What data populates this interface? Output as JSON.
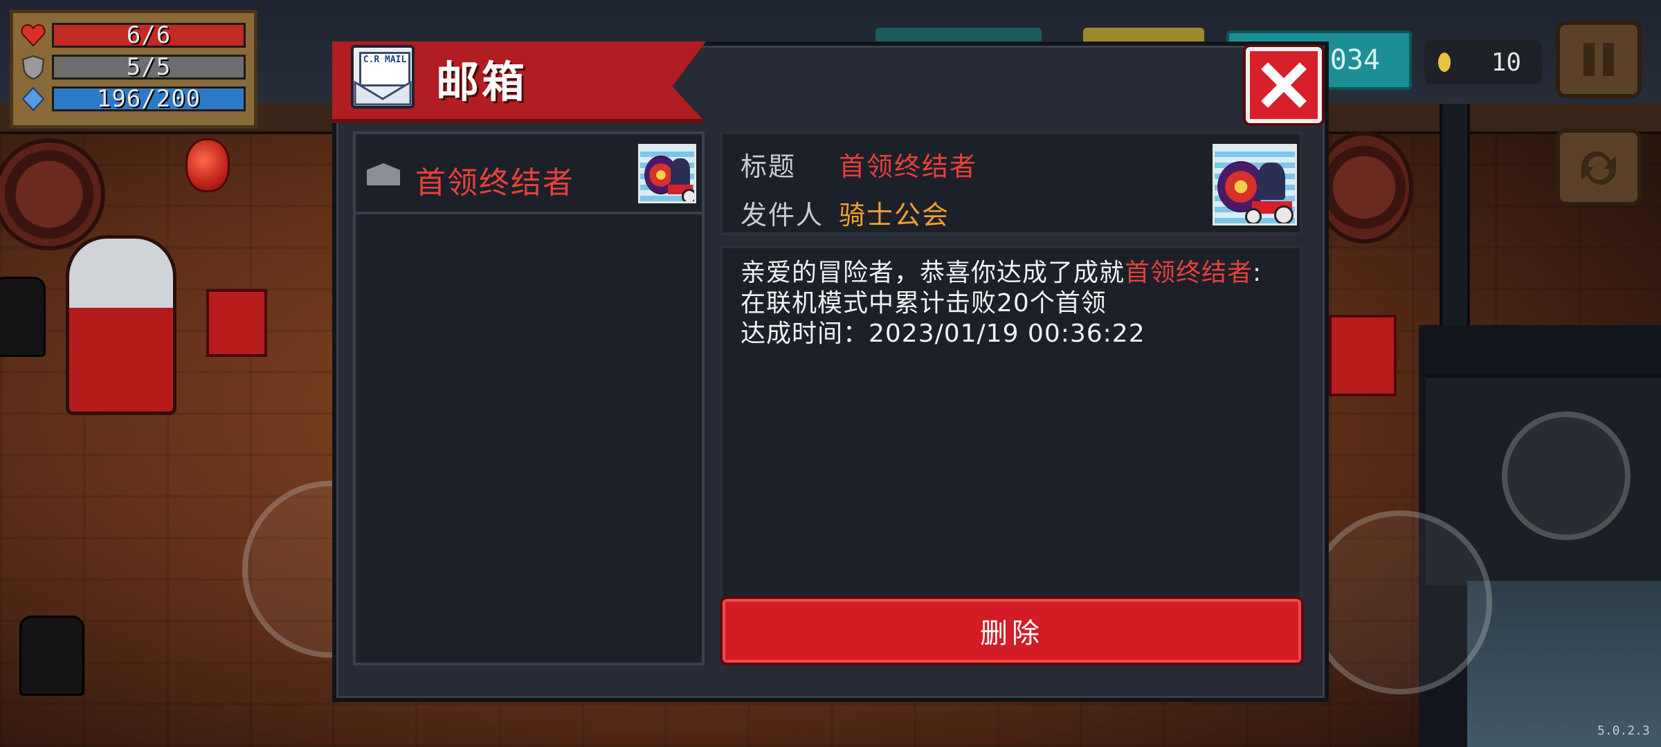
{
  "hud": {
    "hp": "6/6",
    "armor": "5/5",
    "energy": "196/200",
    "gems": "034",
    "coins": "10"
  },
  "icons": {
    "hp": "heart-icon",
    "armor": "shield-icon",
    "energy": "diamond-icon",
    "coin": "coin-icon",
    "pause": "pause-icon",
    "switch": "swap-icon",
    "close": "close-icon",
    "mail": "mail-icon",
    "envelope": "envelope-icon"
  },
  "mailbox": {
    "title": "邮箱",
    "mail_logo_text": "C.R MAIL",
    "list": [
      {
        "label": "首领终结者"
      }
    ],
    "detail": {
      "title_label": "标题",
      "title_value": "首领终结者",
      "sender_label": "发件人",
      "sender_value": "骑士公会",
      "body_prefix": "亲爱的冒险者，恭喜你达成了成就",
      "body_highlight": "首领终结者",
      "body_suffix": ":在联机模式中累计击败20个首领",
      "body_time": "达成时间：2023/01/19 00:36:22"
    },
    "delete_label": "删除"
  },
  "version": "5.0.2.3",
  "colors": {
    "accent_red": "#d41c26",
    "highlight_red": "#e8403a",
    "sender_orange": "#f0a030",
    "panel_bg": "#262b35"
  }
}
